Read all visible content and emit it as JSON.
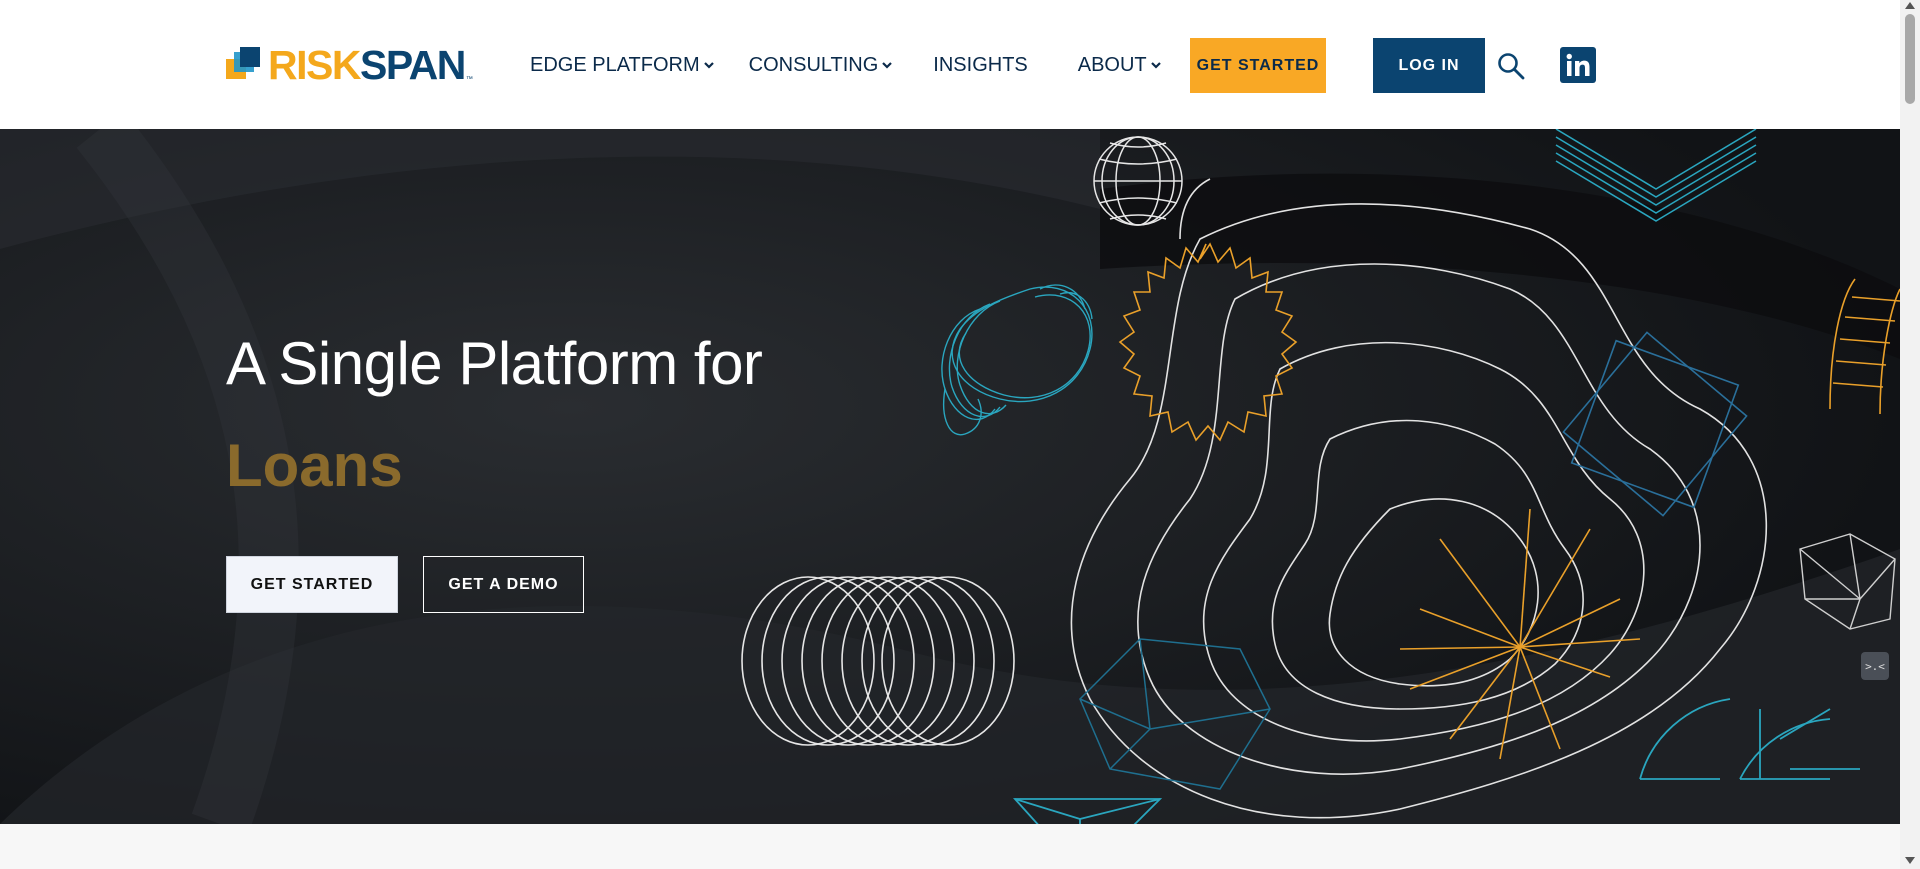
{
  "brand": {
    "logo_risk": "RISK",
    "logo_span": "SPAN",
    "logo_tm": "™",
    "colors": {
      "orange": "#f4a81c",
      "navy": "#0b4470",
      "blue": "#2196c9"
    }
  },
  "nav": {
    "items": [
      {
        "label": "EDGE PLATFORM",
        "has_dropdown": true
      },
      {
        "label": "CONSULTING",
        "has_dropdown": true
      },
      {
        "label": "INSIGHTS",
        "has_dropdown": false
      },
      {
        "label": "ABOUT",
        "has_dropdown": true
      }
    ],
    "get_started": "GET STARTED",
    "log_in": "LOG IN",
    "search_icon": "search-icon",
    "linkedin_icon": "linkedin-icon"
  },
  "hero": {
    "title": "A Single Platform for",
    "highlight": "Loans",
    "highlight_color": "#8a6a2c",
    "primary_cta": "GET STARTED",
    "secondary_cta": "GET A DEMO"
  },
  "chat_widget": {
    "label": ">.<"
  }
}
